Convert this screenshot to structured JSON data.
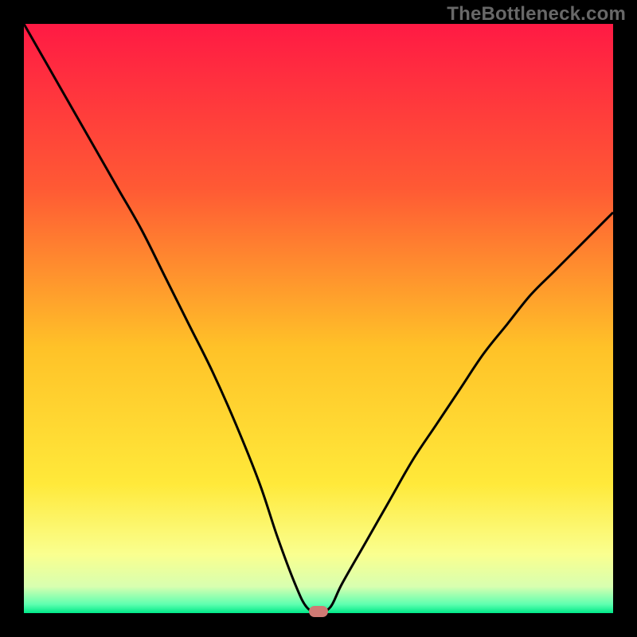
{
  "watermark": "TheBottleneck.com",
  "chart_data": {
    "type": "line",
    "title": "",
    "xlabel": "",
    "ylabel": "",
    "xlim": [
      0,
      100
    ],
    "ylim": [
      0,
      100
    ],
    "grid": false,
    "legend": false,
    "series": [
      {
        "name": "curve",
        "color": "#000000",
        "x": [
          0,
          4,
          8,
          12,
          16,
          20,
          24,
          28,
          32,
          36,
          40,
          43,
          46,
          48,
          50,
          52,
          54,
          58,
          62,
          66,
          70,
          74,
          78,
          82,
          86,
          90,
          94,
          98,
          100
        ],
        "y": [
          100,
          93,
          86,
          79,
          72,
          65,
          57,
          49,
          41,
          32,
          22,
          13,
          5,
          1,
          0.2,
          1,
          5,
          12,
          19,
          26,
          32,
          38,
          44,
          49,
          54,
          58,
          62,
          66,
          68
        ]
      }
    ],
    "marker": {
      "x": 50,
      "y": 0,
      "color": "#cf7a74"
    },
    "gradient_stops": [
      {
        "pos": 0.0,
        "color": "#ff1a44"
      },
      {
        "pos": 0.28,
        "color": "#ff5a34"
      },
      {
        "pos": 0.55,
        "color": "#ffc228"
      },
      {
        "pos": 0.78,
        "color": "#ffe93a"
      },
      {
        "pos": 0.9,
        "color": "#faff8f"
      },
      {
        "pos": 0.955,
        "color": "#d8ffb0"
      },
      {
        "pos": 0.985,
        "color": "#5fffb0"
      },
      {
        "pos": 1.0,
        "color": "#00e888"
      }
    ]
  }
}
